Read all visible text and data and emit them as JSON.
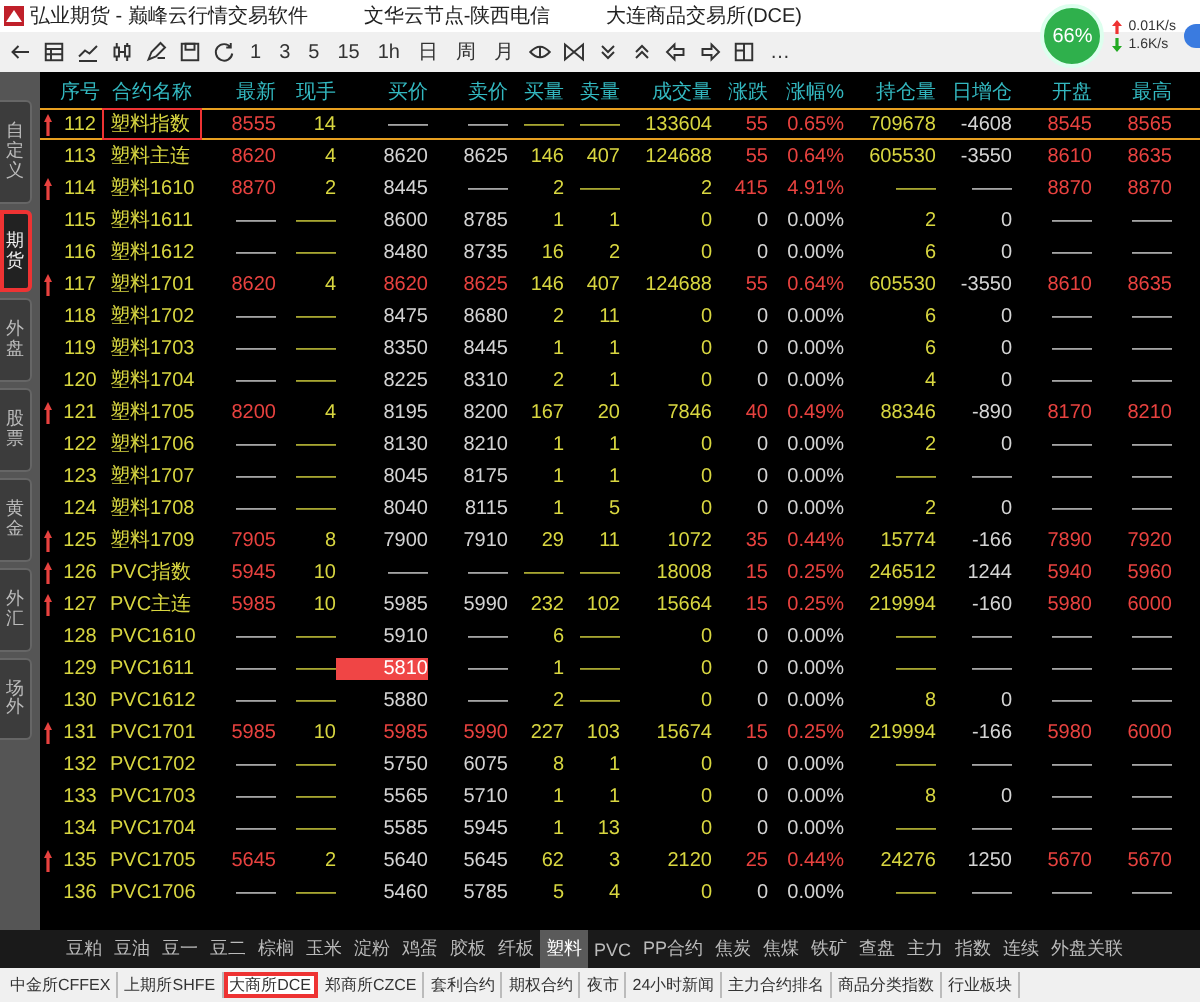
{
  "window": {
    "title_parts": [
      "弘业期货 - 巅峰云行情交易软件",
      "文华云节点-陕西电信",
      "大连商品交易所(DCE)"
    ]
  },
  "toolbar": {
    "periods": [
      "1",
      "3",
      "5",
      "15",
      "1h",
      "日",
      "周",
      "月"
    ],
    "more": "…"
  },
  "network": {
    "gauge": "66%",
    "upload": "0.01K/s",
    "download": "1.6K/s"
  },
  "sidebar": {
    "tabs": [
      {
        "label": "自定义",
        "selected": false
      },
      {
        "label": "期货",
        "selected": true
      },
      {
        "label": "外盘",
        "selected": false
      },
      {
        "label": "股票",
        "selected": false
      },
      {
        "label": "黄金",
        "selected": false
      },
      {
        "label": "外汇",
        "selected": false
      },
      {
        "label": "场外",
        "selected": false
      }
    ]
  },
  "table": {
    "columns": [
      "序号",
      "合约名称",
      "最新",
      "现手",
      "买价",
      "卖价",
      "买量",
      "卖量",
      "成交量",
      "涨跌",
      "涨幅%",
      "持仓量",
      "日增仓",
      "开盘",
      "最高"
    ],
    "rows": [
      {
        "selected": true,
        "marked": true,
        "arrow": true,
        "up": true,
        "bid_ask_up": false,
        "bid_flash": false,
        "cells": [
          "112",
          "塑料指数",
          "8555",
          "14",
          "——",
          "——",
          "——",
          "——",
          "133604",
          "55",
          "0.65%",
          "709678",
          "-4608",
          "8545",
          "8565"
        ]
      },
      {
        "selected": false,
        "marked": false,
        "arrow": false,
        "up": true,
        "bid_ask_up": false,
        "bid_flash": false,
        "cells": [
          "113",
          "塑料主连",
          "8620",
          "4",
          "8620",
          "8625",
          "146",
          "407",
          "124688",
          "55",
          "0.64%",
          "605530",
          "-3550",
          "8610",
          "8635"
        ]
      },
      {
        "selected": false,
        "marked": false,
        "arrow": true,
        "up": true,
        "bid_ask_up": false,
        "bid_flash": false,
        "cells": [
          "114",
          "塑料1610",
          "8870",
          "2",
          "8445",
          "——",
          "2",
          "——",
          "2",
          "415",
          "4.91%",
          "——",
          "——",
          "8870",
          "8870"
        ]
      },
      {
        "selected": false,
        "marked": false,
        "arrow": false,
        "up": false,
        "bid_ask_up": false,
        "bid_flash": false,
        "cells": [
          "115",
          "塑料1611",
          "——",
          "——",
          "8600",
          "8785",
          "1",
          "1",
          "0",
          "0",
          "0.00%",
          "2",
          "0",
          "——",
          "——"
        ]
      },
      {
        "selected": false,
        "marked": false,
        "arrow": false,
        "up": false,
        "bid_ask_up": false,
        "bid_flash": false,
        "cells": [
          "116",
          "塑料1612",
          "——",
          "——",
          "8480",
          "8735",
          "16",
          "2",
          "0",
          "0",
          "0.00%",
          "6",
          "0",
          "——",
          "——"
        ]
      },
      {
        "selected": false,
        "marked": false,
        "arrow": true,
        "up": true,
        "bid_ask_up": true,
        "bid_flash": false,
        "cells": [
          "117",
          "塑料1701",
          "8620",
          "4",
          "8620",
          "8625",
          "146",
          "407",
          "124688",
          "55",
          "0.64%",
          "605530",
          "-3550",
          "8610",
          "8635"
        ]
      },
      {
        "selected": false,
        "marked": false,
        "arrow": false,
        "up": false,
        "bid_ask_up": false,
        "bid_flash": false,
        "cells": [
          "118",
          "塑料1702",
          "——",
          "——",
          "8475",
          "8680",
          "2",
          "11",
          "0",
          "0",
          "0.00%",
          "6",
          "0",
          "——",
          "——"
        ]
      },
      {
        "selected": false,
        "marked": false,
        "arrow": false,
        "up": false,
        "bid_ask_up": false,
        "bid_flash": false,
        "cells": [
          "119",
          "塑料1703",
          "——",
          "——",
          "8350",
          "8445",
          "1",
          "1",
          "0",
          "0",
          "0.00%",
          "6",
          "0",
          "——",
          "——"
        ]
      },
      {
        "selected": false,
        "marked": false,
        "arrow": false,
        "up": false,
        "bid_ask_up": false,
        "bid_flash": false,
        "cells": [
          "120",
          "塑料1704",
          "——",
          "——",
          "8225",
          "8310",
          "2",
          "1",
          "0",
          "0",
          "0.00%",
          "4",
          "0",
          "——",
          "——"
        ]
      },
      {
        "selected": false,
        "marked": false,
        "arrow": true,
        "up": true,
        "bid_ask_up": false,
        "bid_flash": false,
        "cells": [
          "121",
          "塑料1705",
          "8200",
          "4",
          "8195",
          "8200",
          "167",
          "20",
          "7846",
          "40",
          "0.49%",
          "88346",
          "-890",
          "8170",
          "8210"
        ]
      },
      {
        "selected": false,
        "marked": false,
        "arrow": false,
        "up": false,
        "bid_ask_up": false,
        "bid_flash": false,
        "cells": [
          "122",
          "塑料1706",
          "——",
          "——",
          "8130",
          "8210",
          "1",
          "1",
          "0",
          "0",
          "0.00%",
          "2",
          "0",
          "——",
          "——"
        ]
      },
      {
        "selected": false,
        "marked": false,
        "arrow": false,
        "up": false,
        "bid_ask_up": false,
        "bid_flash": false,
        "cells": [
          "123",
          "塑料1707",
          "——",
          "——",
          "8045",
          "8175",
          "1",
          "1",
          "0",
          "0",
          "0.00%",
          "——",
          "——",
          "——",
          "——"
        ]
      },
      {
        "selected": false,
        "marked": false,
        "arrow": false,
        "up": false,
        "bid_ask_up": false,
        "bid_flash": false,
        "cells": [
          "124",
          "塑料1708",
          "——",
          "——",
          "8040",
          "8115",
          "1",
          "5",
          "0",
          "0",
          "0.00%",
          "2",
          "0",
          "——",
          "——"
        ]
      },
      {
        "selected": false,
        "marked": false,
        "arrow": true,
        "up": true,
        "bid_ask_up": false,
        "bid_flash": false,
        "cells": [
          "125",
          "塑料1709",
          "7905",
          "8",
          "7900",
          "7910",
          "29",
          "11",
          "1072",
          "35",
          "0.44%",
          "15774",
          "-166",
          "7890",
          "7920"
        ]
      },
      {
        "selected": false,
        "marked": false,
        "arrow": true,
        "up": true,
        "bid_ask_up": false,
        "bid_flash": false,
        "cells": [
          "126",
          "PVC指数",
          "5945",
          "10",
          "——",
          "——",
          "——",
          "——",
          "18008",
          "15",
          "0.25%",
          "246512",
          "1244",
          "5940",
          "5960"
        ]
      },
      {
        "selected": false,
        "marked": false,
        "arrow": true,
        "up": true,
        "bid_ask_up": false,
        "bid_flash": false,
        "cells": [
          "127",
          "PVC主连",
          "5985",
          "10",
          "5985",
          "5990",
          "232",
          "102",
          "15664",
          "15",
          "0.25%",
          "219994",
          "-160",
          "5980",
          "6000"
        ]
      },
      {
        "selected": false,
        "marked": false,
        "arrow": false,
        "up": false,
        "bid_ask_up": false,
        "bid_flash": false,
        "cells": [
          "128",
          "PVC1610",
          "——",
          "——",
          "5910",
          "——",
          "6",
          "——",
          "0",
          "0",
          "0.00%",
          "——",
          "——",
          "——",
          "——"
        ]
      },
      {
        "selected": false,
        "marked": false,
        "arrow": false,
        "up": false,
        "bid_ask_up": false,
        "bid_flash": true,
        "cells": [
          "129",
          "PVC1611",
          "——",
          "——",
          "5810",
          "——",
          "1",
          "——",
          "0",
          "0",
          "0.00%",
          "——",
          "——",
          "——",
          "——"
        ]
      },
      {
        "selected": false,
        "marked": false,
        "arrow": false,
        "up": false,
        "bid_ask_up": false,
        "bid_flash": false,
        "cells": [
          "130",
          "PVC1612",
          "——",
          "——",
          "5880",
          "——",
          "2",
          "——",
          "0",
          "0",
          "0.00%",
          "8",
          "0",
          "——",
          "——"
        ]
      },
      {
        "selected": false,
        "marked": false,
        "arrow": true,
        "up": true,
        "bid_ask_up": true,
        "bid_flash": false,
        "cells": [
          "131",
          "PVC1701",
          "5985",
          "10",
          "5985",
          "5990",
          "227",
          "103",
          "15674",
          "15",
          "0.25%",
          "219994",
          "-166",
          "5980",
          "6000"
        ]
      },
      {
        "selected": false,
        "marked": false,
        "arrow": false,
        "up": false,
        "bid_ask_up": false,
        "bid_flash": false,
        "cells": [
          "132",
          "PVC1702",
          "——",
          "——",
          "5750",
          "6075",
          "8",
          "1",
          "0",
          "0",
          "0.00%",
          "——",
          "——",
          "——",
          "——"
        ]
      },
      {
        "selected": false,
        "marked": false,
        "arrow": false,
        "up": false,
        "bid_ask_up": false,
        "bid_flash": false,
        "cells": [
          "133",
          "PVC1703",
          "——",
          "——",
          "5565",
          "5710",
          "1",
          "1",
          "0",
          "0",
          "0.00%",
          "8",
          "0",
          "——",
          "——"
        ]
      },
      {
        "selected": false,
        "marked": false,
        "arrow": false,
        "up": false,
        "bid_ask_up": false,
        "bid_flash": false,
        "cells": [
          "134",
          "PVC1704",
          "——",
          "——",
          "5585",
          "5945",
          "1",
          "13",
          "0",
          "0",
          "0.00%",
          "——",
          "——",
          "——",
          "——"
        ]
      },
      {
        "selected": false,
        "marked": false,
        "arrow": true,
        "up": true,
        "bid_ask_up": false,
        "bid_flash": false,
        "cells": [
          "135",
          "PVC1705",
          "5645",
          "2",
          "5640",
          "5645",
          "62",
          "3",
          "2120",
          "25",
          "0.44%",
          "24276",
          "1250",
          "5670",
          "5670"
        ]
      },
      {
        "selected": false,
        "marked": false,
        "arrow": false,
        "up": false,
        "bid_ask_up": false,
        "bid_flash": false,
        "cells": [
          "136",
          "PVC1706",
          "——",
          "——",
          "5460",
          "5785",
          "5",
          "4",
          "0",
          "0",
          "0.00%",
          "——",
          "——",
          "——",
          "——"
        ]
      }
    ]
  },
  "category_tabs": [
    {
      "label": "豆粕",
      "selected": false
    },
    {
      "label": "豆油",
      "selected": false
    },
    {
      "label": "豆一",
      "selected": false
    },
    {
      "label": "豆二",
      "selected": false
    },
    {
      "label": "棕榈",
      "selected": false
    },
    {
      "label": "玉米",
      "selected": false
    },
    {
      "label": "淀粉",
      "selected": false
    },
    {
      "label": "鸡蛋",
      "selected": false
    },
    {
      "label": "胶板",
      "selected": false
    },
    {
      "label": "纤板",
      "selected": false
    },
    {
      "label": "塑料",
      "selected": true
    },
    {
      "label": "PVC",
      "selected": false
    },
    {
      "label": "PP合约",
      "selected": false
    },
    {
      "label": "焦炭",
      "selected": false
    },
    {
      "label": "焦煤",
      "selected": false
    },
    {
      "label": "铁矿",
      "selected": false
    },
    {
      "label": "查盘",
      "selected": false
    },
    {
      "label": "主力",
      "selected": false
    },
    {
      "label": "指数",
      "selected": false
    },
    {
      "label": "连续",
      "selected": false
    },
    {
      "label": "外盘关联",
      "selected": false
    }
  ],
  "exchange_tabs": [
    {
      "label": "中金所CFFEX",
      "selected": false
    },
    {
      "label": "上期所SHFE",
      "selected": false
    },
    {
      "label": "大商所DCE",
      "selected": true
    },
    {
      "label": "郑商所CZCE",
      "selected": false
    },
    {
      "label": "套利合约",
      "selected": false
    },
    {
      "label": "期权合约",
      "selected": false
    },
    {
      "label": "夜市",
      "selected": false
    },
    {
      "label": "24小时新闻",
      "selected": false
    },
    {
      "label": "主力合约排名",
      "selected": false
    },
    {
      "label": "商品分类指数",
      "selected": false
    },
    {
      "label": "行业板块",
      "selected": false
    }
  ]
}
